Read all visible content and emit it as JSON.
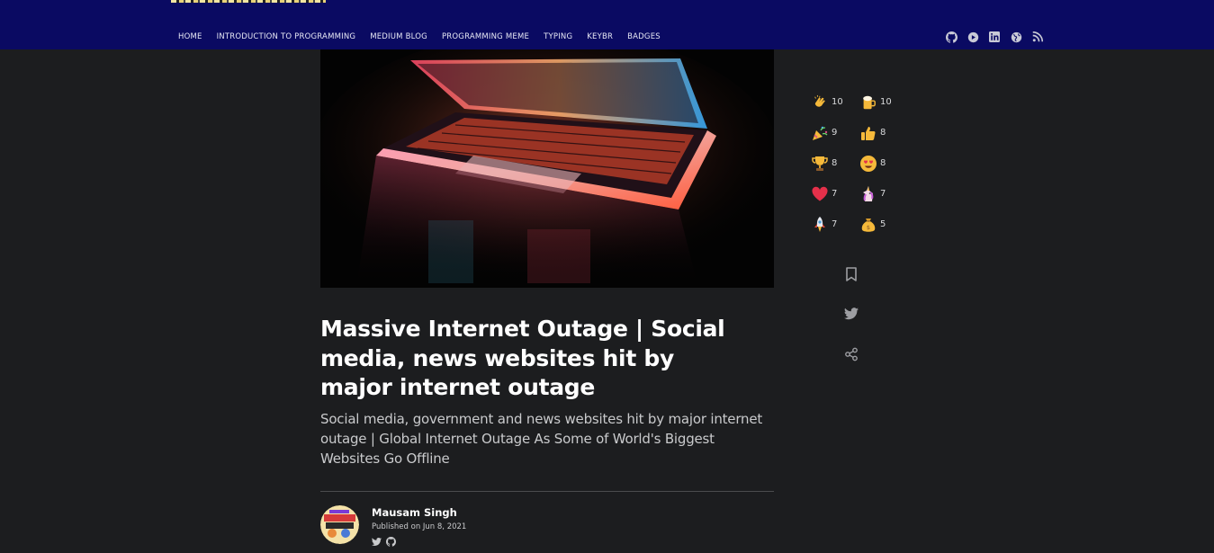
{
  "nav": {
    "items": [
      "HOME",
      "INTRODUCTION TO PROGRAMMING",
      "MEDIUM BLOG",
      "PROGRAMMING MEME",
      "TYPING",
      "KEYBR",
      "BADGES"
    ]
  },
  "social_icons": [
    "github-icon",
    "devto-icon",
    "linkedin-icon",
    "globe-icon",
    "rss-icon"
  ],
  "article": {
    "title": "Massive Internet Outage | Social media, news websites hit by major internet outage",
    "subtitle": "Social media, government and news websites hit by major internet outage | Global Internet Outage As Some of World's Biggest Websites Go Offline",
    "author": {
      "name": "Mausam Singh",
      "published": "Published on Jun 8, 2021"
    }
  },
  "reactions": [
    {
      "emoji": "clap-icon",
      "count": "10"
    },
    {
      "emoji": "beer-icon",
      "count": "10"
    },
    {
      "emoji": "party-popper-icon",
      "count": "9"
    },
    {
      "emoji": "thumbs-up-icon",
      "count": "8"
    },
    {
      "emoji": "trophy-icon",
      "count": "8"
    },
    {
      "emoji": "heart-eyes-icon",
      "count": "8"
    },
    {
      "emoji": "heart-icon",
      "count": "7"
    },
    {
      "emoji": "unicorn-icon",
      "count": "7"
    },
    {
      "emoji": "rocket-icon",
      "count": "7"
    },
    {
      "emoji": "money-bag-icon",
      "count": "5"
    }
  ],
  "colors": {
    "header_bg": "#0a0a62",
    "page_bg": "#1c1d1f",
    "text": "#ffffff",
    "muted": "#c9cacc"
  }
}
